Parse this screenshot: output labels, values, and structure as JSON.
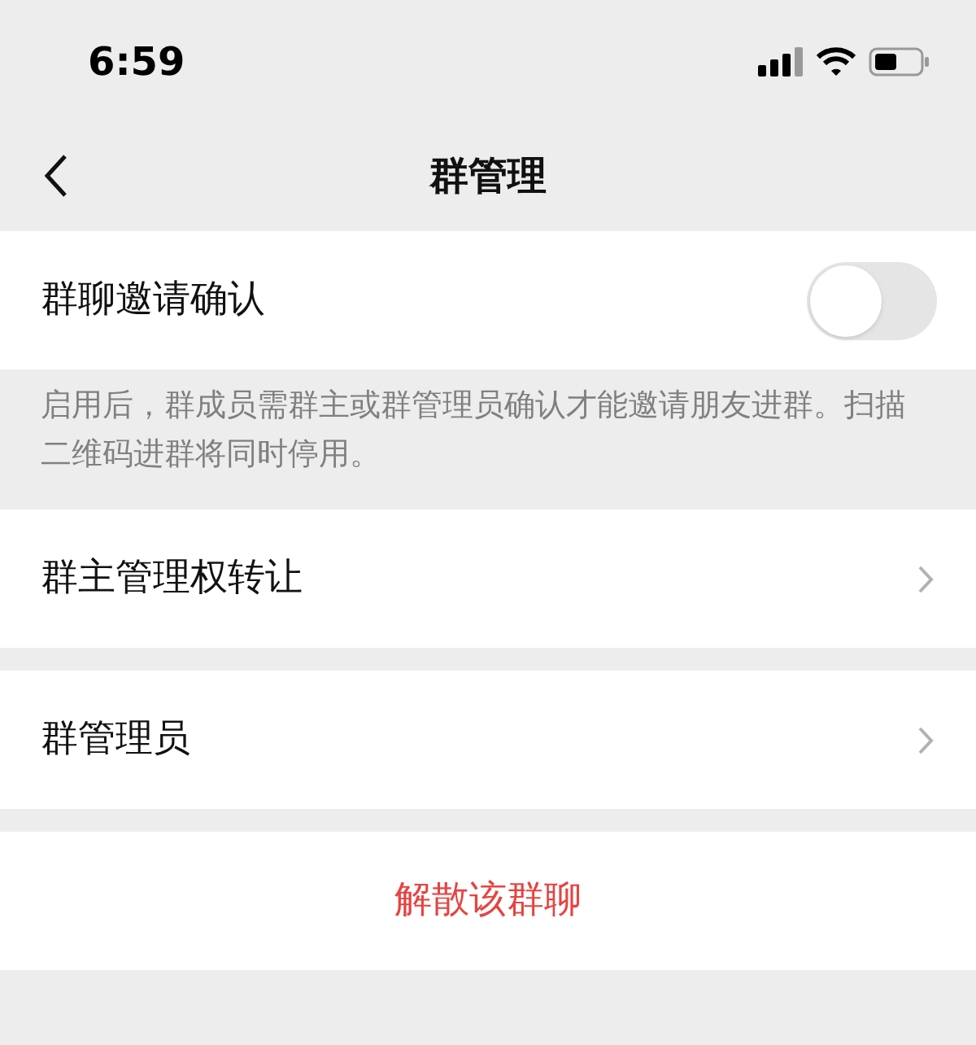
{
  "status_bar": {
    "time": "6:59"
  },
  "nav": {
    "title": "群管理"
  },
  "invite_confirm": {
    "label": "群聊邀请确认",
    "on": false,
    "description": "启用后，群成员需群主或群管理员确认才能邀请朋友进群。扫描二维码进群将同时停用。"
  },
  "menu_items": [
    {
      "label": "群主管理权转让"
    },
    {
      "label": "群管理员"
    }
  ],
  "dissolve_button": {
    "label": "解散该群聊"
  }
}
